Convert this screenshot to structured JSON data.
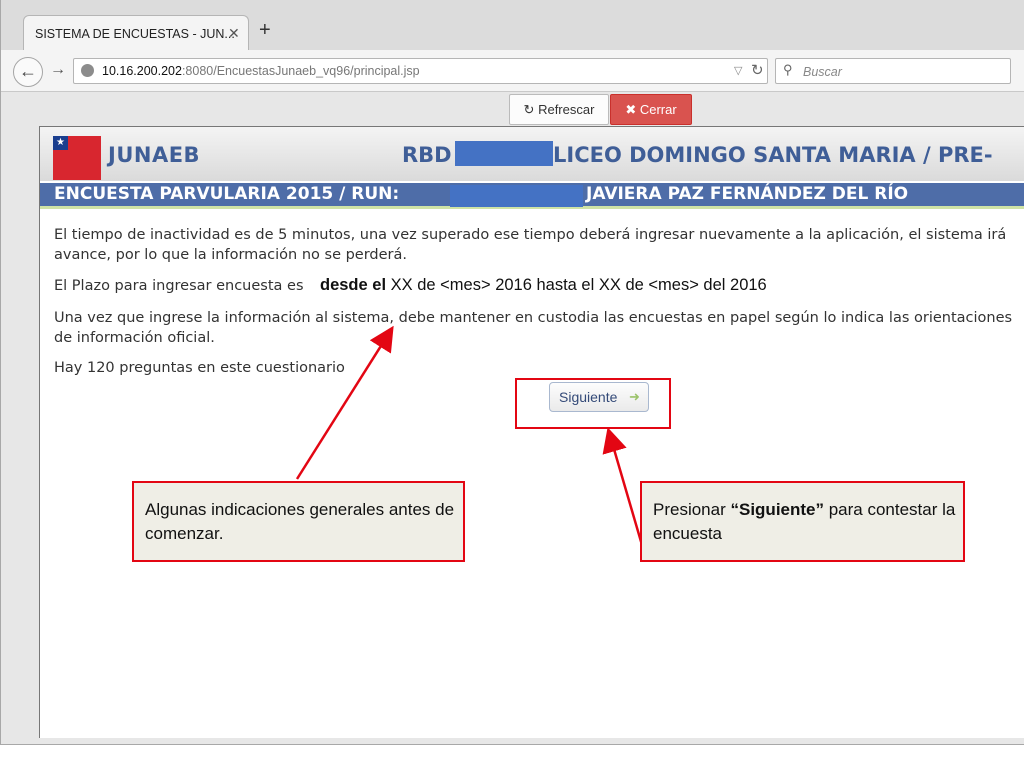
{
  "browser": {
    "tab_title": "SISTEMA DE ENCUESTAS - JUN...",
    "tab_close": "✕",
    "new_tab": "+",
    "url_host": "10.16.200.202",
    "url_path": ":8080/EncuestasJunaeb_vq96/principal.jsp",
    "search_placeholder": "Buscar"
  },
  "toolbar": {
    "refresh_label": "Refrescar",
    "close_label": "Cerrar"
  },
  "header": {
    "brand": "JUNAEB",
    "rbd_label": "RBD",
    "school": "LICEO DOMINGO SANTA MARIA / PRE-",
    "logo_text": "JUNAEB Ministerio de Educación Gobierno de Chile"
  },
  "survey": {
    "title": "ENCUESTA PARVULARIA 2015 / RUN:",
    "student": "JAVIERA PAZ FERNÁNDEZ DEL RÍO"
  },
  "content": {
    "p1_line1": "El tiempo de inactividad es de 5 minutos, una vez superado ese tiempo deberá ingresar nuevamente a la aplicación, el sistema irá",
    "p1_line2": "avance, por lo que la información no se perderá.",
    "p2": "El Plazo para ingresar encuesta es",
    "deadline_bold": "desde el",
    "deadline_rest": " XX de <mes> 2016 hasta el XX de <mes> del 2016",
    "p3_line1": "Una vez que ingrese la información al sistema, debe mantener en custodia las encuestas en papel según lo indica las orientaciones",
    "p3_line2": "de información oficial.",
    "p4": "Hay 120 preguntas en este cuestionario",
    "next_label": "Siguiente"
  },
  "callouts": {
    "left_text": "Algunas indicaciones generales antes de comenzar.",
    "right_prefix": "Presionar ",
    "right_bold": "“Siguiente”",
    "right_suffix": " para contestar la encuesta"
  },
  "colors": {
    "brand_blue": "#3f5e97",
    "survey_bar": "#4e6da8",
    "close_red": "#d9534f",
    "callout_red": "#e30613",
    "callout_bg": "#efeee6"
  }
}
